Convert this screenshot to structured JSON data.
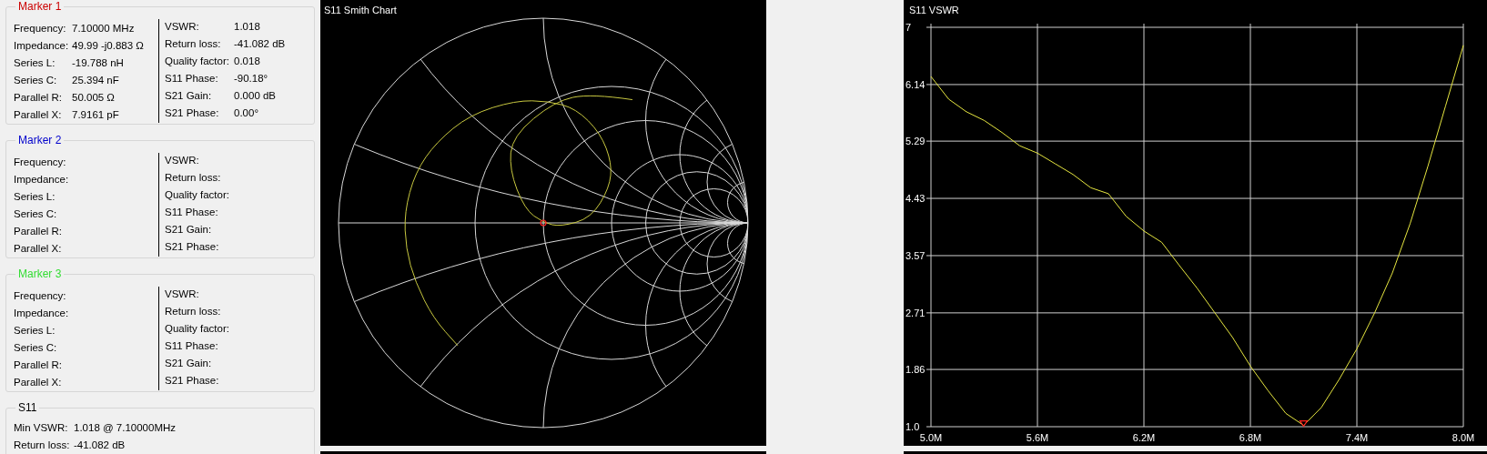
{
  "markers": [
    {
      "title": "Marker 1",
      "color": "#cc0000",
      "left": [
        {
          "label": "Frequency:",
          "value": "7.10000 MHz"
        },
        {
          "label": "Impedance:",
          "value": "49.99 -j0.883 Ω"
        },
        {
          "label": "Series L:",
          "value": "-19.788 nH"
        },
        {
          "label": "Series C:",
          "value": "25.394 nF"
        },
        {
          "label": "Parallel R:",
          "value": "50.005 Ω"
        },
        {
          "label": "Parallel X:",
          "value": "7.9161 pF"
        }
      ],
      "right": [
        {
          "label": "VSWR:",
          "value": "1.018"
        },
        {
          "label": "Return loss:",
          "value": "-41.082 dB"
        },
        {
          "label": "Quality factor:",
          "value": "0.018"
        },
        {
          "label": "S11 Phase:",
          "value": "-90.18°"
        },
        {
          "label": "S21 Gain:",
          "value": "0.000 dB"
        },
        {
          "label": "S21 Phase:",
          "value": "0.00°"
        }
      ]
    },
    {
      "title": "Marker 2",
      "color": "#0000cc",
      "left": [
        {
          "label": "Frequency:"
        },
        {
          "label": "Impedance:"
        },
        {
          "label": "Series L:"
        },
        {
          "label": "Series C:"
        },
        {
          "label": "Parallel R:"
        },
        {
          "label": "Parallel X:"
        }
      ],
      "right": [
        {
          "label": "VSWR:"
        },
        {
          "label": "Return loss:"
        },
        {
          "label": "Quality factor:"
        },
        {
          "label": "S11 Phase:"
        },
        {
          "label": "S21 Gain:"
        },
        {
          "label": "S21 Phase:"
        }
      ]
    },
    {
      "title": "Marker 3",
      "color": "#33dd33",
      "left": [
        {
          "label": "Frequency:"
        },
        {
          "label": "Impedance:"
        },
        {
          "label": "Series L:"
        },
        {
          "label": "Series C:"
        },
        {
          "label": "Parallel R:"
        },
        {
          "label": "Parallel X:"
        }
      ],
      "right": [
        {
          "label": "VSWR:"
        },
        {
          "label": "Return loss:"
        },
        {
          "label": "Quality factor:"
        },
        {
          "label": "S11 Phase:"
        },
        {
          "label": "S21 Gain:"
        },
        {
          "label": "S21 Phase:"
        }
      ]
    }
  ],
  "s11": {
    "title": "S11",
    "rows": [
      {
        "label": "Min VSWR:",
        "value": "1.018 @ 7.10000MHz"
      },
      {
        "label": "Return loss:",
        "value": "-41.082 dB"
      }
    ]
  },
  "smith": {
    "title": "S11 Smith Chart"
  },
  "vswr": {
    "chart_data": {
      "type": "line",
      "title": "S11 VSWR",
      "x": [
        5.0,
        5.1,
        5.2,
        5.3,
        5.4,
        5.5,
        5.6,
        5.7,
        5.8,
        5.9,
        6.0,
        6.1,
        6.2,
        6.3,
        6.4,
        6.5,
        6.6,
        6.7,
        6.8,
        6.9,
        7.0,
        7.1,
        7.2,
        7.3,
        7.4,
        7.5,
        7.6,
        7.7,
        7.8,
        7.9,
        8.0
      ],
      "grid": true,
      "series": [
        {
          "color": "#e6e640",
          "values": [
            6.26,
            5.92,
            5.73,
            5.6,
            5.42,
            5.22,
            5.11,
            4.95,
            4.79,
            4.59,
            4.5,
            4.16,
            3.94,
            3.77,
            3.42,
            3.08,
            2.71,
            2.34,
            1.91,
            1.54,
            1.2,
            1.02,
            1.29,
            1.71,
            2.17,
            2.71,
            3.31,
            4.05,
            4.91,
            5.82,
            6.73
          ]
        }
      ],
      "xlim": [
        5,
        8
      ],
      "ylim": [
        1,
        7
      ],
      "xticks": [
        {
          "value": 5,
          "label": "5.0M"
        },
        {
          "value": 5.6,
          "label": "5.6M"
        },
        {
          "value": 6.2,
          "label": "6.2M"
        },
        {
          "value": 6.8,
          "label": "6.8M"
        },
        {
          "value": 7.4,
          "label": "7.4M"
        },
        {
          "value": 8,
          "label": "8.0M"
        }
      ],
      "yticks": [
        {
          "value": 1,
          "label": "1.0"
        },
        {
          "value": 1.86,
          "label": "1.86"
        },
        {
          "value": 2.71,
          "label": "2.71"
        },
        {
          "value": 3.57,
          "label": "3.57"
        },
        {
          "value": 4.43,
          "label": "4.43"
        },
        {
          "value": 5.29,
          "label": "5.29"
        },
        {
          "value": 6.14,
          "label": "6.14"
        },
        {
          "value": 7,
          "label": "7"
        }
      ]
    }
  }
}
